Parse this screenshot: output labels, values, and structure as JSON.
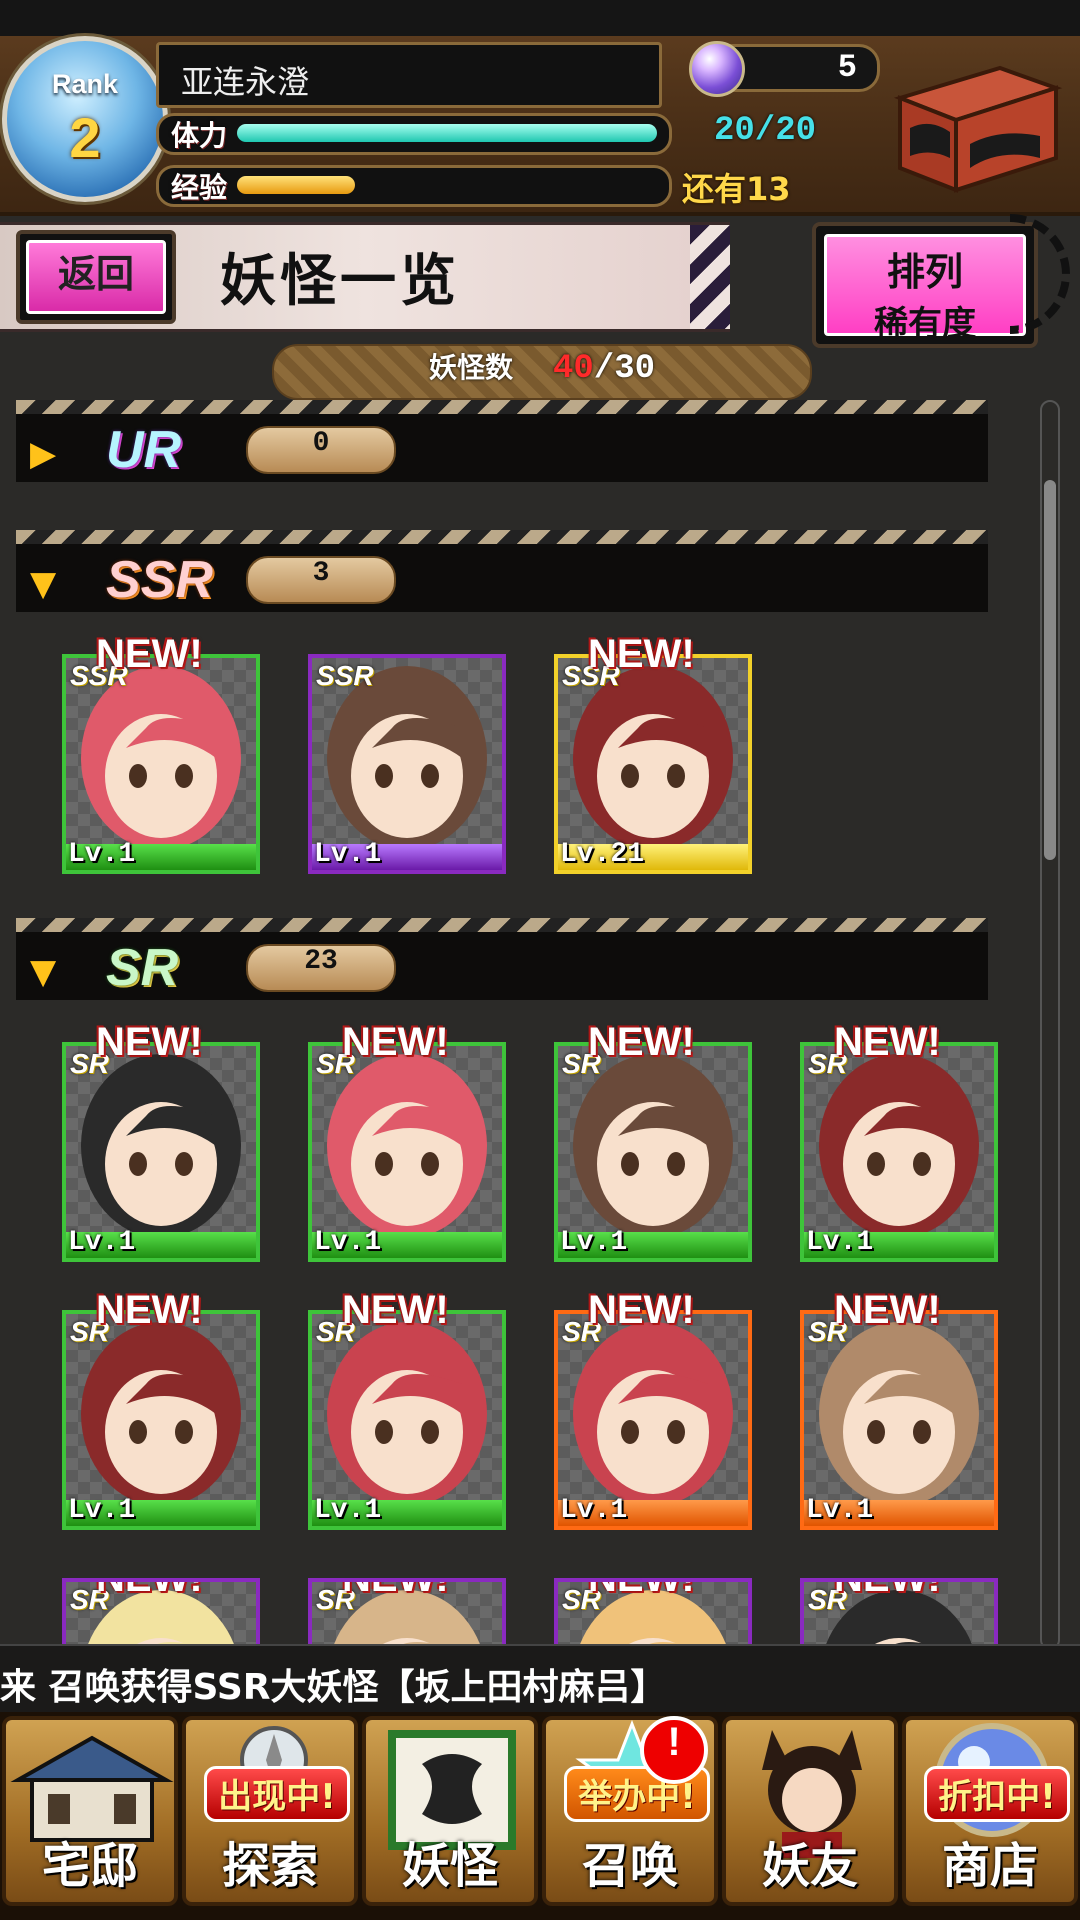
{
  "header": {
    "rank_label": "Rank",
    "rank_value": "2",
    "player_name": "亚连永澄",
    "stamina_label": "体力",
    "stamina_value": "20/20",
    "stamina_fraction": 1.0,
    "exp_label": "经验",
    "exp_remaining": "还有13",
    "exp_fraction": 0.28,
    "gem_count": "5"
  },
  "titlebar": {
    "back_label": "返回",
    "page_title": "妖怪一览",
    "sort_label": "排列",
    "sort_value": "稀有度"
  },
  "counter": {
    "label": "妖怪数",
    "current": "40",
    "separator": "/",
    "max": "30"
  },
  "sections": [
    {
      "rarity": "UR",
      "count": "0",
      "expanded": false
    },
    {
      "rarity": "SSR",
      "count": "3",
      "expanded": true
    },
    {
      "rarity": "SR",
      "count": "23",
      "expanded": true
    }
  ],
  "ssr_cards": [
    {
      "new": "NEW!",
      "tag": "SSR",
      "level": "Lv.1",
      "frame": "green"
    },
    {
      "new": "",
      "tag": "SSR",
      "level": "Lv.1",
      "frame": "purple"
    },
    {
      "new": "NEW!",
      "tag": "SSR",
      "level": "Lv.21",
      "frame": "yellow"
    }
  ],
  "sr_cards": [
    {
      "new": "NEW!",
      "tag": "SR",
      "level": "Lv.1",
      "frame": "green"
    },
    {
      "new": "NEW!",
      "tag": "SR",
      "level": "Lv.1",
      "frame": "green"
    },
    {
      "new": "NEW!",
      "tag": "SR",
      "level": "Lv.1",
      "frame": "green"
    },
    {
      "new": "NEW!",
      "tag": "SR",
      "level": "Lv.1",
      "frame": "green"
    },
    {
      "new": "NEW!",
      "tag": "SR",
      "level": "Lv.1",
      "frame": "green"
    },
    {
      "new": "NEW!",
      "tag": "SR",
      "level": "Lv.1",
      "frame": "green"
    },
    {
      "new": "NEW!",
      "tag": "SR",
      "level": "Lv.1",
      "frame": "orange"
    },
    {
      "new": "NEW!",
      "tag": "SR",
      "level": "Lv.1",
      "frame": "orange"
    },
    {
      "new": "NEW!",
      "tag": "SR",
      "level": "",
      "frame": "purple"
    },
    {
      "new": "NEW!",
      "tag": "SR",
      "level": "",
      "frame": "purple"
    },
    {
      "new": "NEW!",
      "tag": "SR",
      "level": "",
      "frame": "purple"
    },
    {
      "new": "NEW!",
      "tag": "SR",
      "level": "",
      "frame": "purple"
    }
  ],
  "ticker": "来 召唤获得SSR大妖怪【坂上田村麻吕】",
  "nav": {
    "items": [
      {
        "label": "宅邸",
        "badge": ""
      },
      {
        "label": "探索",
        "badge": "出现中!"
      },
      {
        "label": "妖怪",
        "badge": ""
      },
      {
        "label": "召唤",
        "badge": "举办中!"
      },
      {
        "label": "妖友",
        "badge": ""
      },
      {
        "label": "商店",
        "badge": "折扣中!"
      }
    ],
    "alert": "!"
  }
}
